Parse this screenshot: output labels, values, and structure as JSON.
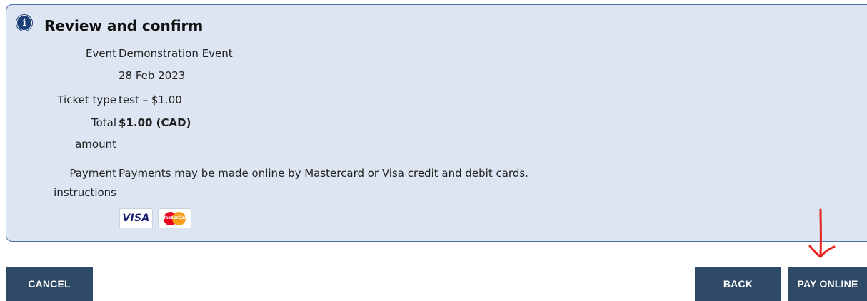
{
  "panel": {
    "title": "Review and confirm",
    "info_icon": "info-icon",
    "rows": {
      "event": {
        "label": "Event",
        "value": "Demonstration Event",
        "date": "28 Feb 2023"
      },
      "ticket": {
        "label": "Ticket type",
        "value": "test – $1.00"
      },
      "total": {
        "label_line1": "Total",
        "label_line2": "amount",
        "value": "$1.00 (CAD)"
      },
      "payment": {
        "label_line1": "Payment",
        "label_line2": "instructions",
        "value": "Payments may be made online by Mastercard or Visa credit and debit cards."
      }
    },
    "cards": {
      "visa": "VISA",
      "mastercard": "MasterCard"
    }
  },
  "buttons": {
    "cancel": "CANCEL",
    "back": "BACK",
    "pay_online": "PAY ONLINE"
  },
  "colors": {
    "panel_bg": "#dce5f1",
    "panel_border": "#4a6fa5",
    "button_bg": "#2f4a66",
    "annotation_arrow": "#e8231a"
  }
}
